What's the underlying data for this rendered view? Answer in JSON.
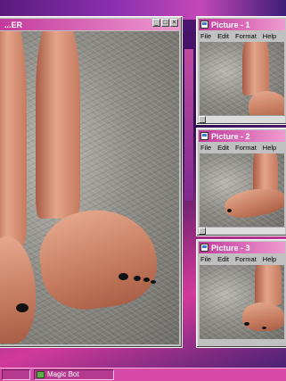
{
  "main_window": {
    "title": "...ER"
  },
  "windows": [
    {
      "title": "Picture - 1",
      "menu": [
        "File",
        "Edit",
        "Format",
        "Help"
      ]
    },
    {
      "title": "Picture - 2",
      "menu": [
        "File",
        "Edit",
        "Format",
        "Help"
      ]
    },
    {
      "title": "Picture - 3",
      "menu": [
        "File",
        "Edit",
        "Format",
        "Help"
      ]
    }
  ],
  "taskbar": {
    "items": [
      {
        "label": ""
      },
      {
        "label": "Magic Bot"
      }
    ]
  },
  "colors": {
    "title_start": "#c23a9c",
    "title_end": "#f09ad0",
    "nail": "#111111",
    "taskbar": "#d84aa7"
  }
}
